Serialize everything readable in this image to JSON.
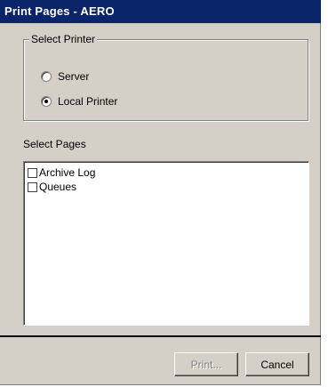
{
  "window": {
    "title": "Print Pages - AERO"
  },
  "printer_group": {
    "legend": "Select Printer",
    "options": [
      {
        "label": "Server",
        "checked": false
      },
      {
        "label": "Local Printer",
        "checked": true
      }
    ]
  },
  "pages": {
    "label": "Select Pages",
    "items": [
      {
        "label": "Archive Log",
        "checked": false
      },
      {
        "label": "Queues",
        "checked": false
      }
    ]
  },
  "buttons": {
    "print": "Print...",
    "cancel": "Cancel"
  }
}
